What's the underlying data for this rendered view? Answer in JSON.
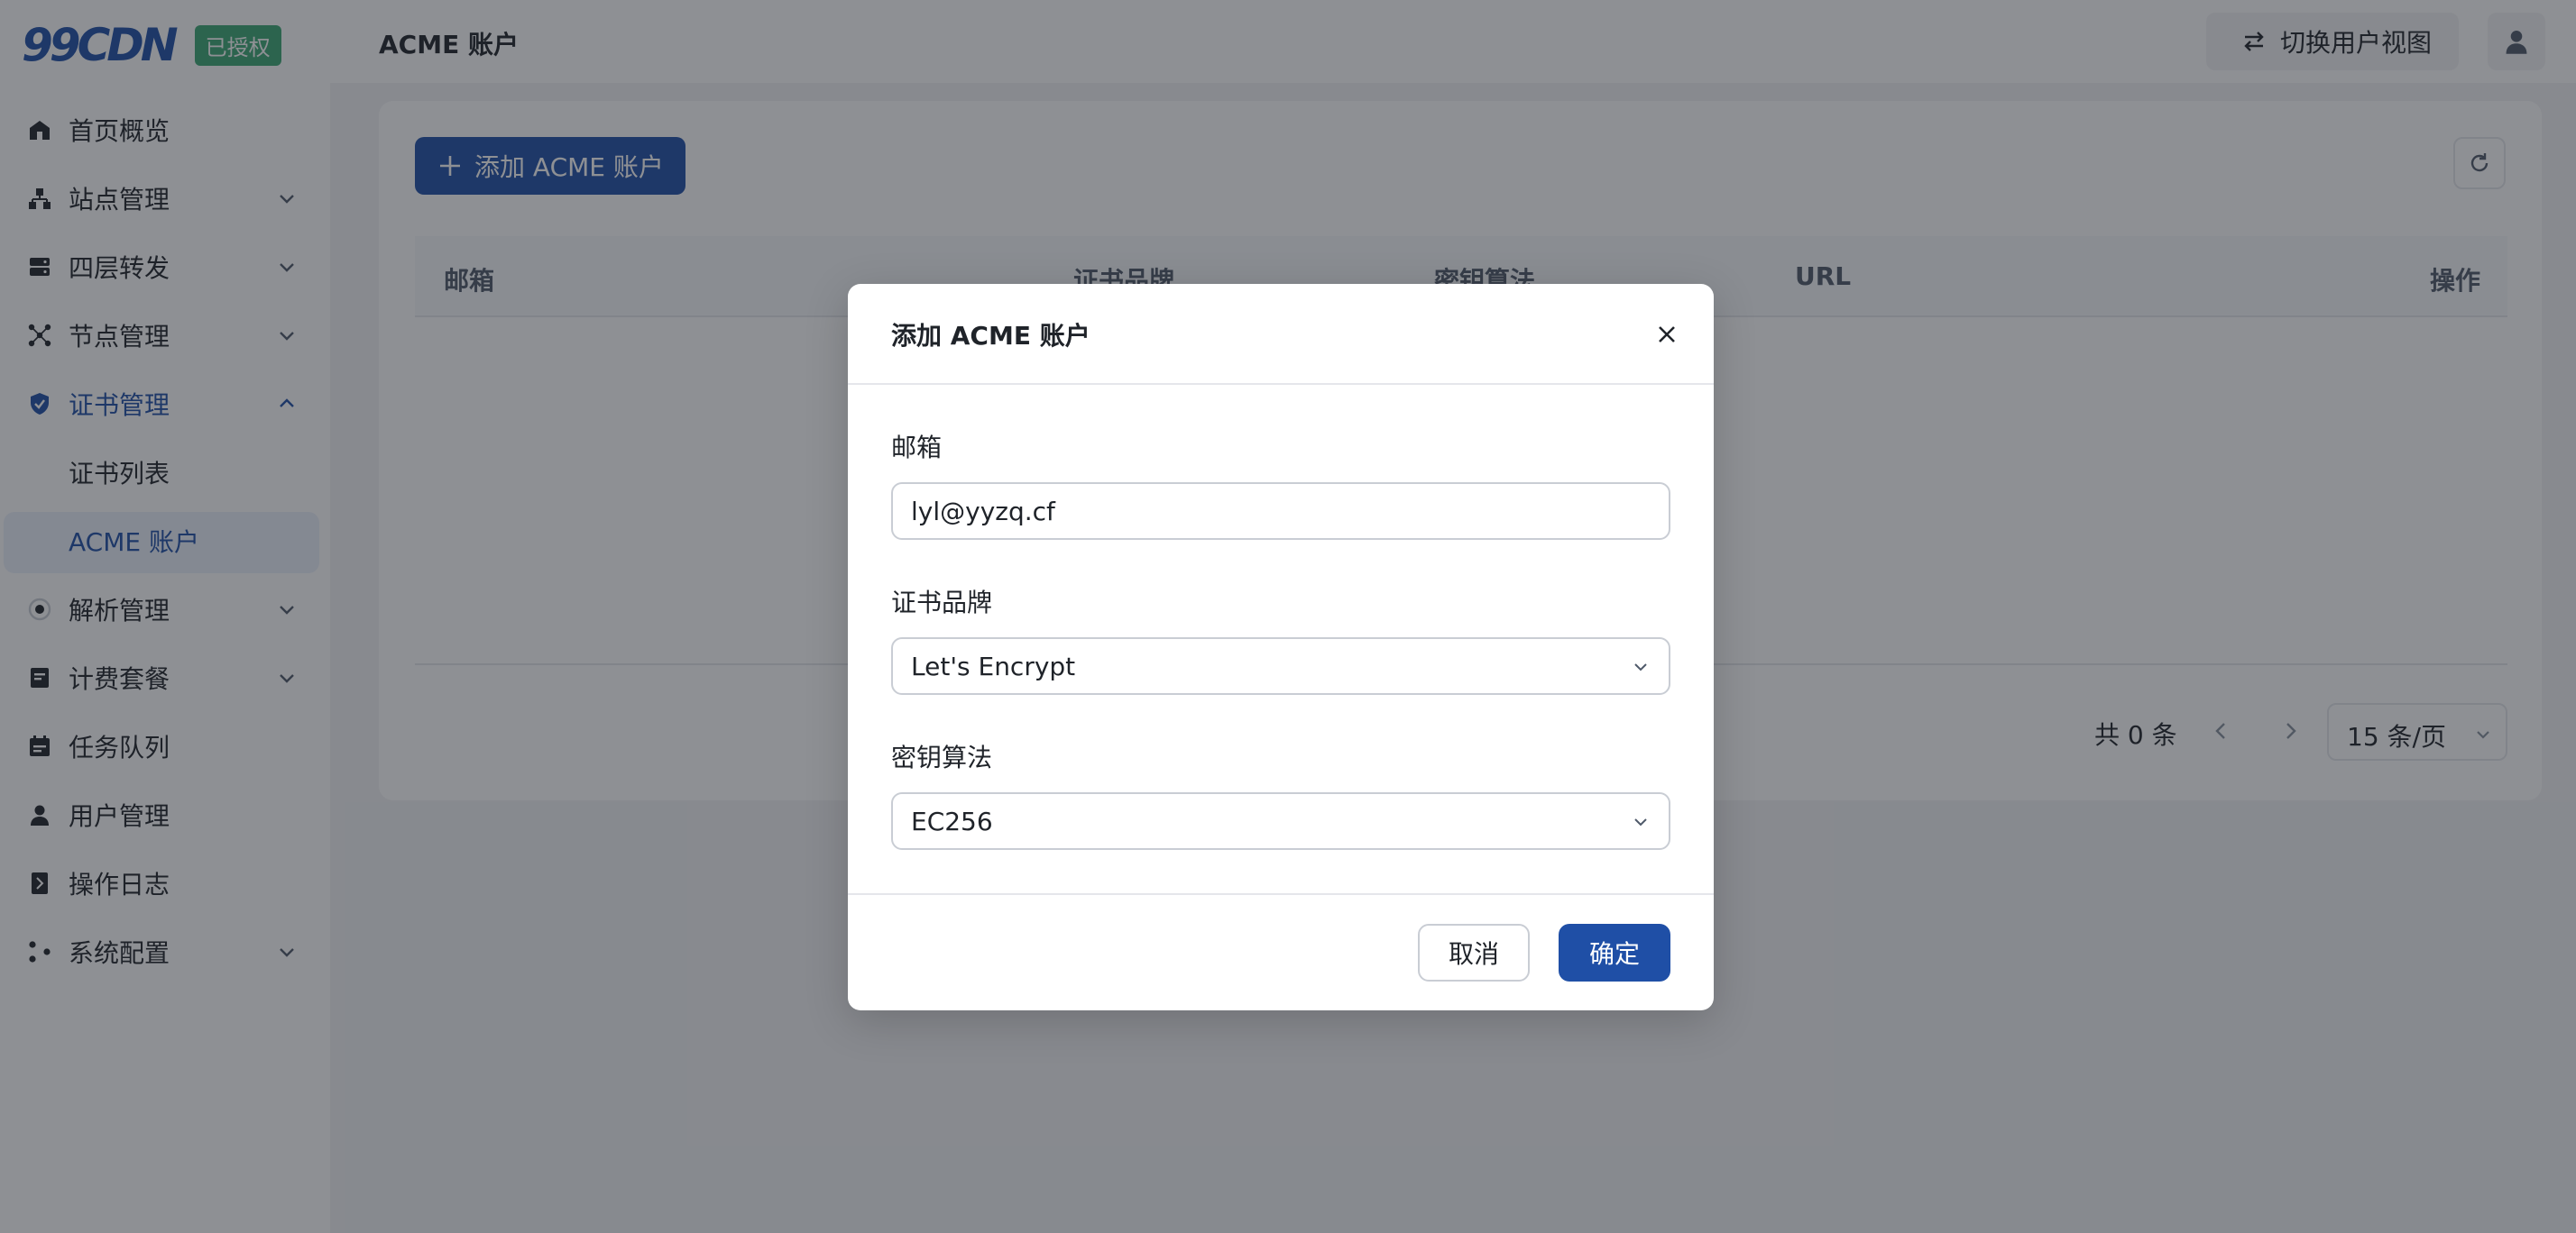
{
  "brand": {
    "logo": "99CDN",
    "badge": "已授权"
  },
  "sidebar": {
    "items": [
      {
        "label": "首页概览"
      },
      {
        "label": "站点管理"
      },
      {
        "label": "四层转发"
      },
      {
        "label": "节点管理"
      },
      {
        "label": "证书管理"
      },
      {
        "label": "证书列表"
      },
      {
        "label": "ACME 账户"
      },
      {
        "label": "解析管理"
      },
      {
        "label": "计费套餐"
      },
      {
        "label": "任务队列"
      },
      {
        "label": "用户管理"
      },
      {
        "label": "操作日志"
      },
      {
        "label": "系统配置"
      }
    ]
  },
  "header": {
    "title": "ACME 账户",
    "switch_view": "切换用户视图"
  },
  "main": {
    "add_button": "添加 ACME 账户",
    "table": {
      "columns": [
        "邮箱",
        "证书品牌",
        "密钥算法",
        "URL",
        "操作"
      ]
    },
    "pager": {
      "total": "共 0 条",
      "page_size": "15 条/页"
    }
  },
  "modal": {
    "title": "添加 ACME 账户",
    "email": {
      "label": "邮箱",
      "value": "lyl@yyzq.cf"
    },
    "brand": {
      "label": "证书品牌",
      "value": "Let's Encrypt"
    },
    "algorithm": {
      "label": "密钥算法",
      "value": "EC256"
    },
    "cancel": "取消",
    "ok": "确定"
  },
  "colors": {
    "primary": "#1f4fa6",
    "badge": "#3aa673",
    "mask": "rgba(29,33,41,0.5)"
  }
}
